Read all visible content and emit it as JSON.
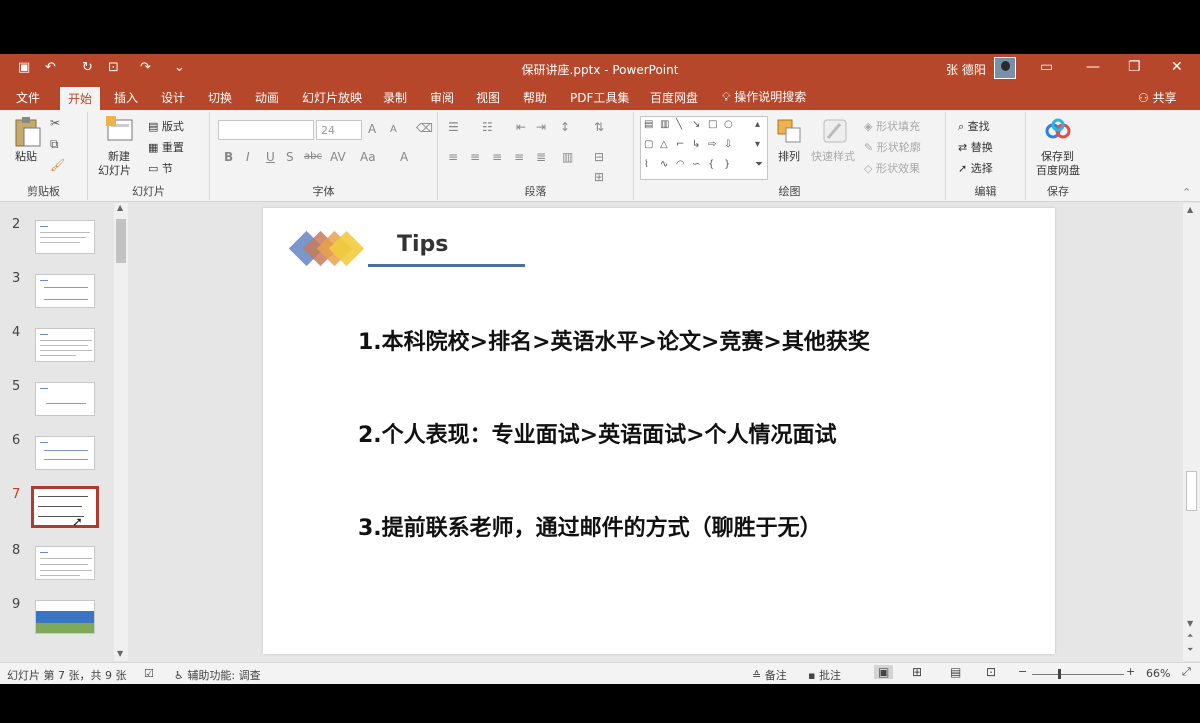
{
  "window": {
    "title": "保研讲座.pptx  -  PowerPoint",
    "user": "张 德阳"
  },
  "tabs": [
    "文件",
    "开始",
    "插入",
    "设计",
    "切换",
    "动画",
    "幻灯片放映",
    "录制",
    "审阅",
    "视图",
    "帮助",
    "PDF工具集",
    "百度网盘"
  ],
  "tell_me": "操作说明搜索",
  "share": "共享",
  "ribbon": {
    "clipboard": {
      "label": "剪贴板",
      "paste": "粘贴"
    },
    "slides": {
      "label": "幻灯片",
      "new_slide_1": "新建",
      "new_slide_2": "幻灯片",
      "layout": "版式",
      "reset": "重置",
      "section": "节"
    },
    "font": {
      "label": "字体",
      "size": "24"
    },
    "paragraph": {
      "label": "段落"
    },
    "drawing": {
      "label": "绘图",
      "arrange": "排列",
      "quick_styles": "快速样式",
      "shape_fill": "形状填充",
      "shape_outline": "形状轮廓",
      "shape_effects": "形状效果"
    },
    "editing": {
      "label": "编辑",
      "find": "查找",
      "replace": "替换",
      "select": "选择"
    },
    "save": {
      "label": "保存",
      "save_to_1": "保存到",
      "save_to_2": "百度网盘"
    }
  },
  "thumbnails": [
    "2",
    "3",
    "4",
    "5",
    "6",
    "7",
    "8",
    "9"
  ],
  "slide": {
    "title": "Tips",
    "points": [
      "1.本科院校>排名>英语水平>论文>竞赛>其他获奖",
      "2.个人表现：专业面试>英语面试>个人情况面试",
      "3.提前联系老师，通过邮件的方式（聊胜于无）"
    ]
  },
  "status": {
    "slide_info": "幻灯片 第 7 张，共 9 张",
    "accessibility": "辅助功能: 调查",
    "notes": "备注",
    "comments": "批注",
    "zoom": "66%"
  },
  "colors": {
    "accent": "#b7472a",
    "active_thumb": "#b03a2e"
  }
}
